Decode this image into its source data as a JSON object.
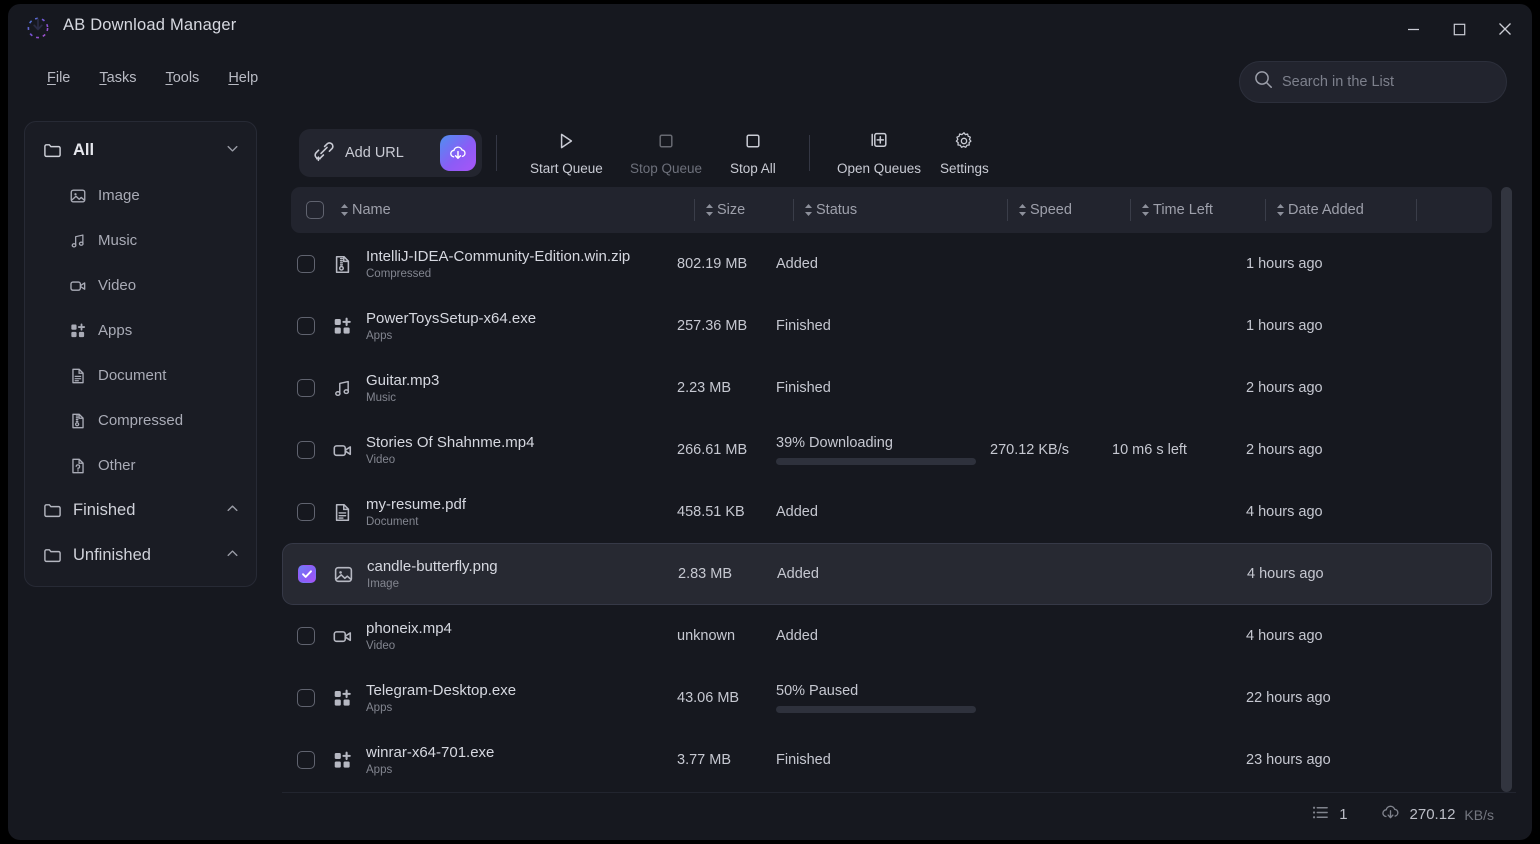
{
  "window": {
    "title": "AB Download Manager",
    "controls": {
      "minimize": "minimize",
      "maximize": "maximize",
      "close": "close"
    }
  },
  "menubar": [
    {
      "label": "File",
      "accel": "F"
    },
    {
      "label": "Tasks",
      "accel": "T"
    },
    {
      "label": "Tools",
      "accel": "T"
    },
    {
      "label": "Help",
      "accel": "H"
    }
  ],
  "search": {
    "placeholder": "Search in the List",
    "value": "",
    "icon": "search-icon"
  },
  "sidebar": {
    "groups": [
      {
        "label": "All",
        "icon": "folder-icon",
        "chevron": "chevron-down-icon",
        "active": true,
        "expanded": true,
        "children": [
          {
            "label": "Image",
            "icon": "image-icon"
          },
          {
            "label": "Music",
            "icon": "music-icon"
          },
          {
            "label": "Video",
            "icon": "video-icon"
          },
          {
            "label": "Apps",
            "icon": "apps-icon"
          },
          {
            "label": "Document",
            "icon": "document-icon"
          },
          {
            "label": "Compressed",
            "icon": "compressed-icon"
          },
          {
            "label": "Other",
            "icon": "other-file-icon"
          }
        ]
      },
      {
        "label": "Finished",
        "icon": "folder-icon",
        "chevron": "chevron-up-icon",
        "active": false,
        "expanded": false,
        "children": []
      },
      {
        "label": "Unfinished",
        "icon": "folder-icon",
        "chevron": "chevron-up-icon",
        "active": false,
        "expanded": false,
        "children": []
      }
    ]
  },
  "toolbar": {
    "add_url_label": "Add URL",
    "add_url_icon": "link-plus-icon",
    "add_url_action_icon": "cloud-download-icon",
    "buttons": [
      {
        "label": "Start Queue",
        "icon": "play-icon",
        "disabled": false
      },
      {
        "label": "Stop Queue",
        "icon": "stop-square-icon",
        "disabled": true
      },
      {
        "label": "Stop All",
        "icon": "stop-square-icon",
        "disabled": false
      },
      {
        "label": "Open Queues",
        "icon": "queue-add-icon",
        "disabled": false
      },
      {
        "label": "Settings",
        "icon": "gear-icon",
        "disabled": false
      }
    ]
  },
  "table": {
    "columns": [
      {
        "label": "Name",
        "sort_icon": "sort-icon"
      },
      {
        "label": "Size",
        "sort_icon": "sort-icon"
      },
      {
        "label": "Status",
        "sort_icon": "sort-icon"
      },
      {
        "label": "Speed",
        "sort_icon": "sort-icon"
      },
      {
        "label": "Time Left",
        "sort_icon": "sort-icon"
      },
      {
        "label": "Date Added",
        "sort_icon": "sort-icon"
      }
    ],
    "select_all_checked": false,
    "rows": [
      {
        "checked": false,
        "selected": false,
        "icon": "compressed-icon",
        "name": "IntelliJ-IDEA-Community-Edition.win.zip",
        "category": "Compressed",
        "size": "802.19 MB",
        "status": "Added",
        "progress": null,
        "progress_state": null,
        "speed": "",
        "time_left": "",
        "date_added": "1 hours ago"
      },
      {
        "checked": false,
        "selected": false,
        "icon": "apps-icon",
        "name": "PowerToysSetup-x64.exe",
        "category": "Apps",
        "size": "257.36 MB",
        "status": "Finished",
        "progress": null,
        "progress_state": null,
        "speed": "",
        "time_left": "",
        "date_added": "1 hours ago"
      },
      {
        "checked": false,
        "selected": false,
        "icon": "music-icon",
        "name": "Guitar.mp3",
        "category": "Music",
        "size": "2.23 MB",
        "status": "Finished",
        "progress": null,
        "progress_state": null,
        "speed": "",
        "time_left": "",
        "date_added": "2 hours ago"
      },
      {
        "checked": false,
        "selected": false,
        "icon": "video-icon",
        "name": "Stories Of Shahnme.mp4",
        "category": "Video",
        "size": "266.61 MB",
        "status": "39% Downloading",
        "progress": 39,
        "progress_state": "downloading",
        "speed": "270.12 KB/s",
        "time_left": "10 m6 s left",
        "date_added": "2 hours ago"
      },
      {
        "checked": false,
        "selected": false,
        "icon": "document-icon",
        "name": "my-resume.pdf",
        "category": "Document",
        "size": "458.51 KB",
        "status": "Added",
        "progress": null,
        "progress_state": null,
        "speed": "",
        "time_left": "",
        "date_added": "4 hours ago"
      },
      {
        "checked": true,
        "selected": true,
        "icon": "image-icon",
        "name": "candle-butterfly.png",
        "category": "Image",
        "size": "2.83 MB",
        "status": "Added",
        "progress": null,
        "progress_state": null,
        "speed": "",
        "time_left": "",
        "date_added": "4 hours ago"
      },
      {
        "checked": false,
        "selected": false,
        "icon": "video-icon",
        "name": "phoneix.mp4",
        "category": "Video",
        "size": "unknown",
        "status": "Added",
        "progress": null,
        "progress_state": null,
        "speed": "",
        "time_left": "",
        "date_added": "4 hours ago"
      },
      {
        "checked": false,
        "selected": false,
        "icon": "apps-icon",
        "name": "Telegram-Desktop.exe",
        "category": "Apps",
        "size": "43.06 MB",
        "status": "50% Paused",
        "progress": 50,
        "progress_state": "paused",
        "speed": "",
        "time_left": "",
        "date_added": "22 hours ago"
      },
      {
        "checked": false,
        "selected": false,
        "icon": "apps-icon",
        "name": "winrar-x64-701.exe",
        "category": "Apps",
        "size": "3.77 MB",
        "status": "Finished",
        "progress": null,
        "progress_state": null,
        "speed": "",
        "time_left": "",
        "date_added": "23 hours ago"
      }
    ]
  },
  "statusbar": {
    "list_icon": "list-icon",
    "active_count": "1",
    "speed_icon": "cloud-download-icon",
    "speed_value": "270.12",
    "speed_unit": "KB/s"
  },
  "colors": {
    "window_bg": "#16181f",
    "panel_bg": "#1a1c24",
    "header_bg": "#22242e",
    "accent_blue": "#4f8ff0",
    "accent_purple": "#a855f7",
    "progress_paused": "#f9b23c",
    "text_primary": "#d6d8e0",
    "text_secondary": "#9ea0ab"
  }
}
